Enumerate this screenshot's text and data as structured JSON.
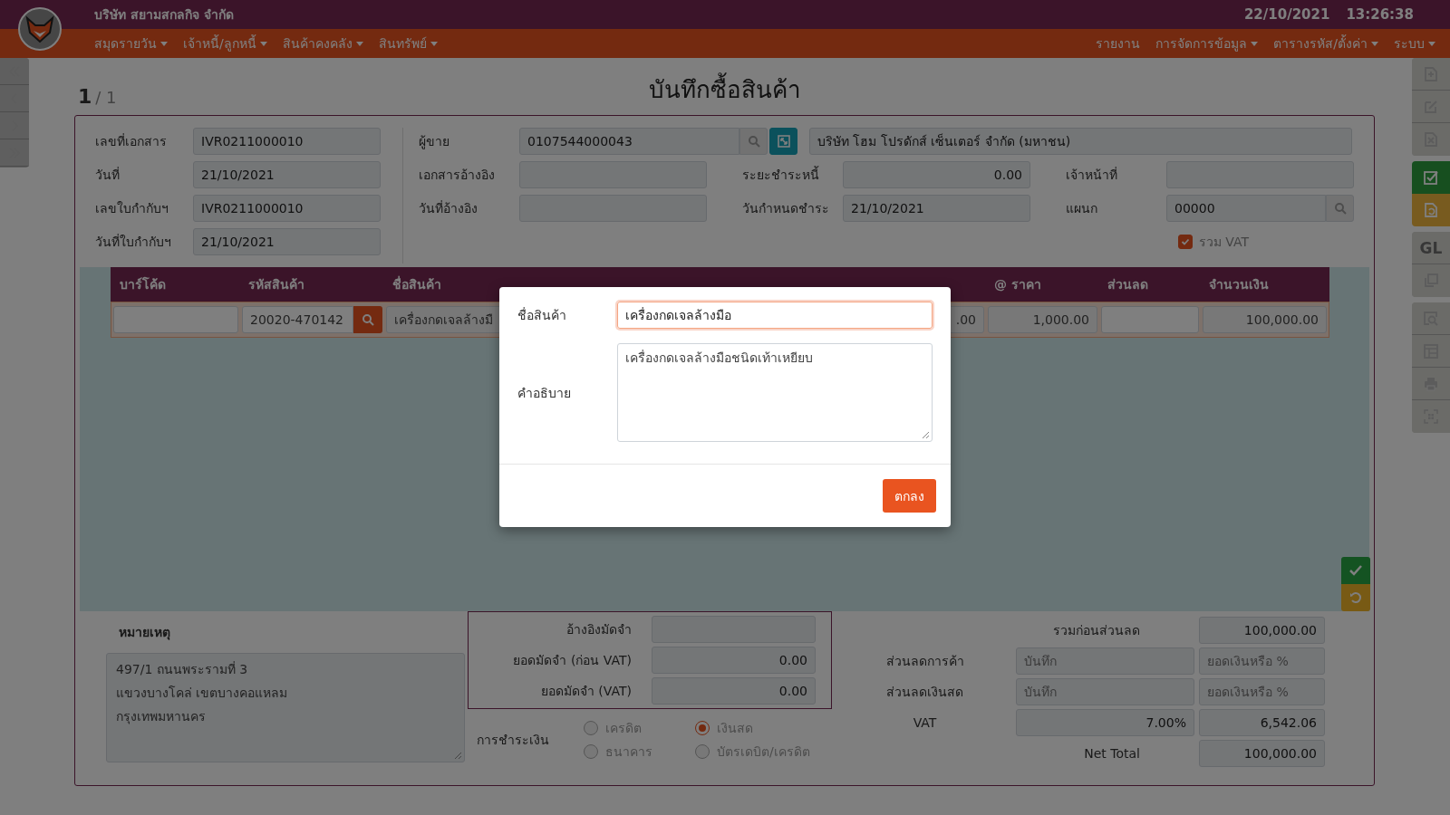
{
  "app": {
    "company": "บริษัท สยามสกลกิจ จำกัด",
    "date": "22/10/2021",
    "time": "13:26:38"
  },
  "menu_left": [
    {
      "label": "สมุดรายวัน",
      "dropdown": true
    },
    {
      "label": "เจ้าหนี้/ลูกหนี้",
      "dropdown": true
    },
    {
      "label": "สินค้าคงคลัง",
      "dropdown": true
    },
    {
      "label": "สินทรัพย์",
      "dropdown": true
    }
  ],
  "menu_right": [
    {
      "label": "รายงาน",
      "dropdown": false
    },
    {
      "label": "การจัดการข้อมูล",
      "dropdown": true
    },
    {
      "label": "ตารางรหัส/ตั้งค่า",
      "dropdown": true
    },
    {
      "label": "ระบบ",
      "dropdown": true
    }
  ],
  "pager": {
    "current": "1",
    "total": "/ 1"
  },
  "title": "บันทึกซื้อสินค้า",
  "doc_fields": [
    {
      "label": "เลขที่เอกสาร",
      "value": "IVR0211000010"
    },
    {
      "label": "วันที่",
      "value": "21/10/2021"
    },
    {
      "label": "เลขใบกำกับฯ",
      "value": "IVR0211000010"
    },
    {
      "label": "วันที่ใบกำกับฯ",
      "value": "21/10/2021"
    }
  ],
  "supplier": {
    "label": "ผู้ขาย",
    "code": "0107544000043",
    "name": "บริษัท โฮม โปรดักส์ เซ็นเตอร์ จำกัด (มหาชน)"
  },
  "detail_fields": [
    {
      "label": "เอกสารอ้างอิง",
      "kind": "text"
    },
    {
      "label": "ระยะชำระหนี้",
      "value": "0.00",
      "kind": "number"
    },
    {
      "label": "เจ้าหน้าที่",
      "kind": "text"
    },
    {
      "label": "วันที่อ้างอิง",
      "kind": "text"
    },
    {
      "label": "วันกำหนดชำระ",
      "value": "21/10/2021",
      "kind": "text"
    },
    {
      "label": "แผนก",
      "value": "00000",
      "kind": "lookup"
    }
  ],
  "vat_included": {
    "label": "รวม VAT",
    "checked": true
  },
  "items_table": {
    "columns": [
      "บาร์โค้ด",
      "รหัสสินค้า",
      "ชื่อสินค้า",
      "@ ราคา",
      "ส่วนลด",
      "จำนวนเงิน"
    ],
    "rows": [
      {
        "code": "20020-470142",
        "name": "เครื่องกดเจลล้างมื",
        "quantity": ".00",
        "price": "1,000.00",
        "amount": "100,000.00"
      }
    ]
  },
  "remarks": {
    "label": "หมายเหตุ",
    "lines": [
      "497/1 ถนนพระรามที่ 3",
      "แขวงบางโคล่ เขตบางคอแหลม",
      "กรุงเทพมหานคร"
    ]
  },
  "deposit": [
    {
      "label": "อ้างอิงมัดจำ"
    },
    {
      "label": "ยอดมัดจำ (ก่อน VAT)",
      "value": "0.00"
    },
    {
      "label": "ยอดมัดจำ (VAT)",
      "value": "0.00"
    }
  ],
  "payment": {
    "label": "การชำระเงิน",
    "options": [
      {
        "label": "เครดิต",
        "selected": false
      },
      {
        "label": "เงินสด",
        "selected": true
      },
      {
        "label": "ธนาคาร",
        "selected": false
      },
      {
        "label": "บัตรเดบิต/เครดิต",
        "selected": false
      }
    ]
  },
  "totals": [
    {
      "label": "รวมก่อนส่วนลด",
      "fields": [
        {
          "value": "100,000.00"
        }
      ]
    },
    {
      "label": "ส่วนลดการค้า",
      "fields": [
        {
          "placeholder": "บันทึก"
        },
        {
          "placeholder": "ยอดเงินหรือ %"
        }
      ]
    },
    {
      "label": "ส่วนลดเงินสด",
      "fields": [
        {
          "placeholder": "บันทึก"
        },
        {
          "placeholder": "ยอดเงินหรือ %"
        }
      ]
    },
    {
      "label": "VAT",
      "fields": [
        {
          "value": "7.00%"
        },
        {
          "value": "6,542.06"
        }
      ]
    },
    {
      "label": "Net Total",
      "fields": [
        {
          "value": "100,000.00"
        }
      ]
    }
  ],
  "toolbar_gl": "GL",
  "modal": {
    "fields": [
      {
        "label": "ชื่อสินค้า",
        "value": "เครื่องกดเจลล้างมือ",
        "kind": "input",
        "focused": true
      },
      {
        "label": "คำอธิบาย",
        "value": "เครื่องกดเจลล้างมือชนิดเท้าเหยียบ",
        "kind": "textarea",
        "focused": false
      }
    ],
    "ok": "ตกลง"
  }
}
